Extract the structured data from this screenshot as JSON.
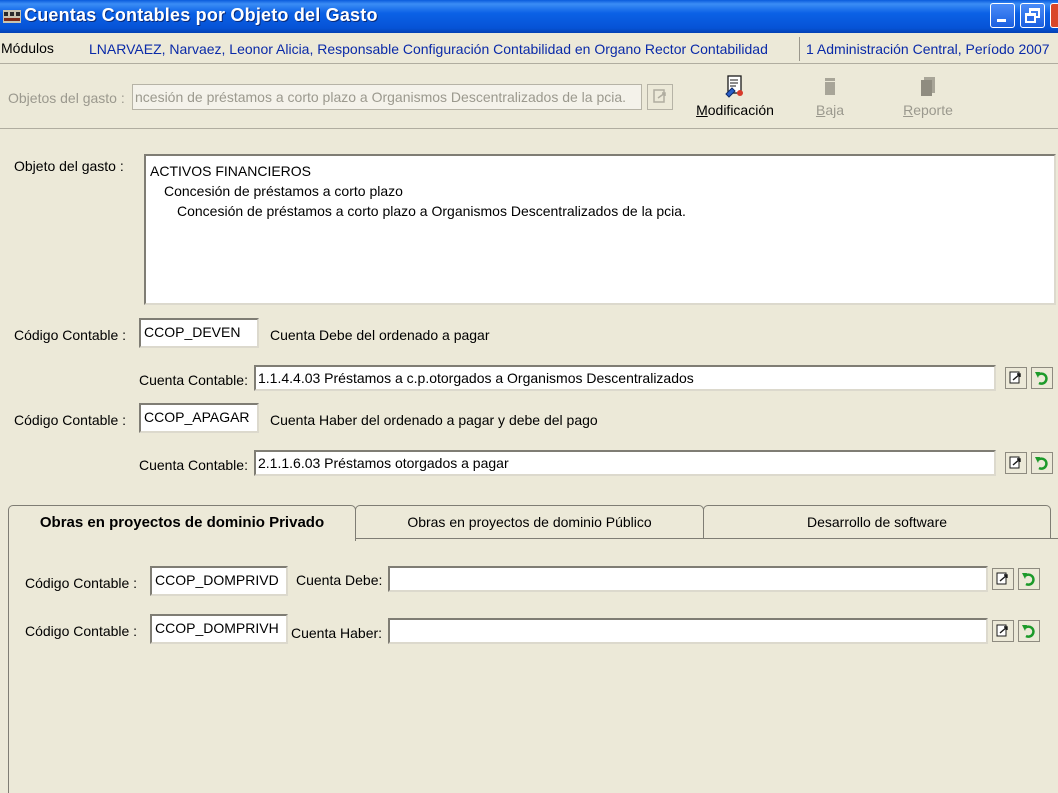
{
  "window": {
    "title": "Cuentas Contables por Objeto del Gasto"
  },
  "infobar": {
    "modules": "Módulos",
    "user": "LNARVAEZ, Narvaez, Leonor Alicia, Responsable Configuración Contabilidad en Organo Rector Contabilidad",
    "org": "1 Administración Central, Período 2007"
  },
  "toolbar": {
    "objetos_label": "Objetos del gasto :",
    "objetos_value": "ncesión de préstamos a corto plazo a Organismos Descentralizados de la pcia.",
    "modificacion_first": "M",
    "modificacion_rest": "odificación",
    "baja_first": "B",
    "baja_rest": "aja",
    "reporte_first": "R",
    "reporte_rest": "eporte"
  },
  "form": {
    "objeto_label": "Objeto del gasto :",
    "objeto_lines": [
      "ACTIVOS FINANCIEROS",
      "Concesión de préstamos a corto plazo",
      "Concesión de préstamos a corto plazo a Organismos Descentralizados de la pcia."
    ],
    "debe": {
      "codigo_label": "Código Contable :",
      "codigo_value": "CCOP_DEVEN",
      "descripcion": "Cuenta Debe del ordenado a pagar",
      "cuenta_label": "Cuenta Contable:",
      "cuenta_value": "1.1.4.4.03 Préstamos a c.p.otorgados a Organismos Descentralizados"
    },
    "haber": {
      "codigo_label": "Código Contable :",
      "codigo_value": "CCOP_APAGAR",
      "descripcion": "Cuenta Haber del ordenado a pagar y debe del pago",
      "cuenta_label": "Cuenta Contable:",
      "cuenta_value": "2.1.1.6.03 Préstamos otorgados a pagar"
    }
  },
  "tabs": [
    {
      "label": "Obras en proyectos de dominio Privado",
      "active": true
    },
    {
      "label": "Obras en proyectos de dominio Público",
      "active": false
    },
    {
      "label": "Desarrollo de software",
      "active": false
    }
  ],
  "tab_page": {
    "row1": {
      "codigo_label": "Código Contable :",
      "codigo_value": "CCOP_DOMPRIVD",
      "cuenta_label": "Cuenta Debe:",
      "cuenta_value": ""
    },
    "row2": {
      "codigo_label": "Código Contable :",
      "codigo_value": "CCOP_DOMPRIVH",
      "cuenta_label": "Cuenta Haber:",
      "cuenta_value": ""
    }
  },
  "colors": {
    "titlebar": "#0653d6",
    "link_blue": "#0a2aa8",
    "face": "#ece9d8",
    "disabled": "#9b998e"
  }
}
